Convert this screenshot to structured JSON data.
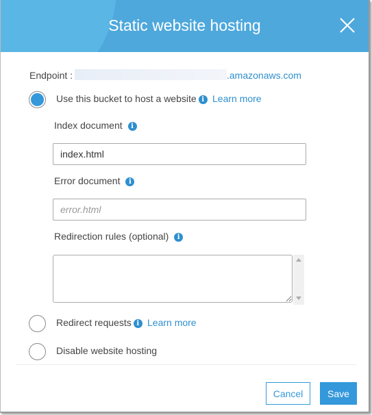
{
  "header": {
    "title": "Static website hosting",
    "close_icon": "close-icon"
  },
  "endpoint": {
    "label": "Endpoint :",
    "suffix": ".amazonaws.com"
  },
  "options": [
    {
      "label": "Use this bucket to host a website",
      "learn_more": "Learn more",
      "selected": true
    },
    {
      "label": "Redirect requests",
      "learn_more": "Learn more",
      "selected": false
    },
    {
      "label": "Disable website hosting",
      "selected": false
    }
  ],
  "form": {
    "index_label": "Index document",
    "index_value": "index.html",
    "error_label": "Error document",
    "error_placeholder": "error.html",
    "redirect_label": "Redirection rules (optional)"
  },
  "info_glyph": "i",
  "footer": {
    "cancel": "Cancel",
    "save": "Save"
  },
  "colors": {
    "header": "#4ea8dc",
    "accent": "#3498db",
    "link": "#2e8fcf"
  }
}
